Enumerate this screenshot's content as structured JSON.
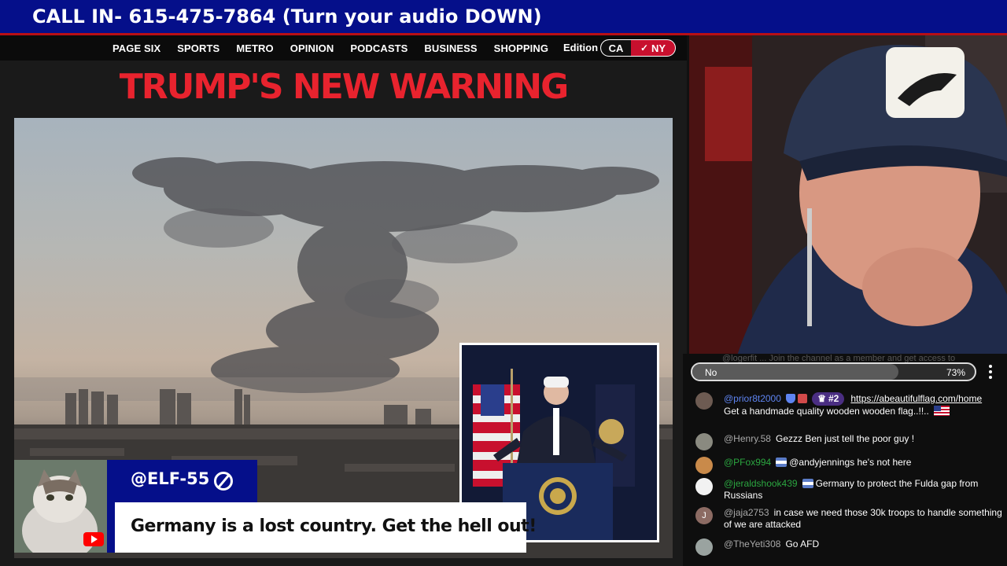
{
  "banner": {
    "text": "CALL IN- 615-475-7864 (Turn your audio DOWN)"
  },
  "article": {
    "nav": [
      "PAGE SIX",
      "SPORTS",
      "METRO",
      "OPINION",
      "PODCASTS",
      "BUSINESS",
      "SHOPPING"
    ],
    "edition_label": "Edition",
    "edition_ca": "CA",
    "edition_ny": "NY",
    "edition_check": "✓",
    "headline": "TRUMP'S NEW WARNING"
  },
  "superchat": {
    "name": "@ELF-55",
    "message": "Germany is a lost country. Get the hell out!"
  },
  "chat": {
    "ghost_text": "@logerfit ... Join the channel as a member and get access to",
    "poll": {
      "label": "No",
      "percent_text": "73%",
      "percent": 73
    },
    "messages": [
      {
        "author": "@prior8t2000",
        "rank": "#2",
        "link": "https://abeautifulflag.com/home",
        "text": "Get a handmade quality wooden wooden flag..!!.."
      },
      {
        "author": "@Henry.58",
        "text": "Gezzz Ben just tell the poor guy !"
      },
      {
        "author": "@PFox994",
        "text": "@andyjennings he's not here"
      },
      {
        "author": "@jeraldshook439",
        "text": "Germany to protect the Fulda gap from Russians"
      },
      {
        "author": "@jaja2753",
        "avatar_letter": "J",
        "text": "in case we need those 30k troops to handle something of we are attacked"
      },
      {
        "author": "@TheYeti308",
        "text": "Go AFD"
      }
    ]
  },
  "colors": {
    "banner_bg": "#050f8a",
    "headline_red": "#e8232e",
    "member_green": "#2ba640",
    "accent_red": "#c8102e"
  }
}
